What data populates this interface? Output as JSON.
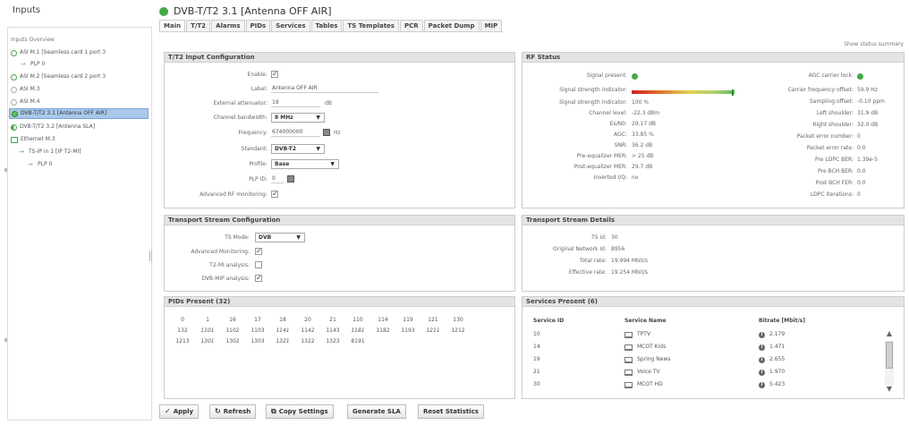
{
  "sidebar": {
    "title": "Inputs",
    "overview": "Inputs Overview",
    "items": [
      {
        "label": "ASI M.1 [Seamless card 1 port 3",
        "icon": "ring-icon"
      },
      {
        "label": "PLP 0",
        "icon": "plp-icon"
      },
      {
        "label": "ASI M.2 [Seamless card 2 port 3",
        "icon": "ring-icon"
      },
      {
        "label": "ASI M.3",
        "icon": "ring-empty-icon"
      },
      {
        "label": "ASI M.4",
        "icon": "ring-empty-icon"
      },
      {
        "label": "DVB-T/T2 3.1 [Antenna OFF AIR]",
        "icon": "ring-selected-icon"
      },
      {
        "label": "DVB-T/T2 3.2 [Antenna SLA]",
        "icon": "ring-half-icon"
      },
      {
        "label": "Ethernet M.3",
        "icon": "ethernet-icon"
      },
      {
        "label": "TS-IP in 1 [IP T2-MI]",
        "icon": "ts-ip-icon"
      },
      {
        "label": "PLP 0",
        "icon": "plp-icon"
      }
    ]
  },
  "header": {
    "title": "DVB-T/T2 3.1 [Antenna OFF AIR]",
    "status_color": "#44aa44"
  },
  "tabs": [
    "Main",
    "T/T2",
    "Alarms",
    "PIDs",
    "Services",
    "Tables",
    "TS Templates",
    "PCR",
    "Packet Dump",
    "MIP"
  ],
  "show_status_summary": "Show status summary",
  "t2_input": {
    "title": "T/T2 Input Configuration",
    "enable_label": "Enable:",
    "enable_checked": true,
    "label_label": "Label:",
    "label_value": "Antenna OFF AIR",
    "ext_att_label": "External attenuator:",
    "ext_att_value": "19",
    "ext_att_unit": "dB",
    "bandwidth_label": "Channel bandwidth:",
    "bandwidth_value": "8 MHz",
    "freq_label": "Frequency:",
    "freq_value": "674000000",
    "freq_unit": "Hz",
    "standard_label": "Standard:",
    "standard_value": "DVB-T2",
    "profile_label": "Profile:",
    "profile_value": "Base",
    "plp_label": "PLP ID:",
    "plp_value": "0",
    "adv_rf_label": "Advanced RF monitoring:",
    "adv_rf_checked": true
  },
  "rf_status": {
    "title": "RF Status",
    "signal_present_label": "Signal present:",
    "signal_strength_label": "Signal strength indicator:",
    "signal_strength_fraction": 0.97,
    "signal_strength_ind_label": "Signal strength indicator:",
    "signal_strength_ind_value": "100 %",
    "channel_level_label": "Channel level:",
    "channel_level_value": "-22.3 dBm",
    "esno_label": "Es/N0:",
    "esno_value": "29.17 dB",
    "agc_label": "AGC:",
    "agc_value": "33.85 %",
    "snr_label": "SNR:",
    "snr_value": "36.2 dB",
    "pre_mer_label": "Pre-equalizer MER:",
    "pre_mer_value": "> 25 dB",
    "post_mer_label": "Post-equalizer MER:",
    "post_mer_value": "29.7 dB",
    "inv_iq_label": "Inverted I/Q:",
    "inv_iq_value": "no",
    "agc_lock_label": "AGC carrier lock:",
    "cfo_label": "Carrier frequency offset:",
    "cfo_value": "59.9 Hz",
    "so_label": "Sampling offset:",
    "so_value": "-0.10 ppm",
    "ls_label": "Left shoulder:",
    "ls_value": "31.9 dB",
    "rs_label": "Right shoulder:",
    "rs_value": "32.0 dB",
    "pen_label": "Packet error number:",
    "pen_value": "0",
    "per_label": "Packet error rate:",
    "per_value": "0.0",
    "pre_ldpc_label": "Pre LDPC BER:",
    "pre_ldpc_value": "1.39e-5",
    "pre_bch_label": "Pre BCH BER:",
    "pre_bch_value": "0.0",
    "post_bch_label": "Post BCH FER:",
    "post_bch_value": "0.0",
    "ldpc_it_label": "LDPC iterations:",
    "ldpc_it_value": "0"
  },
  "ts_config": {
    "title": "Transport Stream Configuration",
    "mode_label": "TS Mode:",
    "mode_value": "DVB",
    "adv_mon_label": "Advanced Monitoring:",
    "adv_mon_checked": true,
    "t2mi_label": "T2-MI analysis:",
    "t2mi_checked": false,
    "dvbmip_label": "DVB-MIP analysis:",
    "dvbmip_checked": true
  },
  "ts_details": {
    "title": "Transport Stream Details",
    "tsid_label": "TS id:",
    "tsid_value": "30",
    "onid_label": "Original Network Id:",
    "onid_value": "8956",
    "total_label": "Total rate:",
    "total_value": "19.994 Mbit/s",
    "eff_label": "Effective rate:",
    "eff_value": "19.254 Mbit/s"
  },
  "pids": {
    "title": "PIDs Present (32)",
    "rows": [
      [
        {
          "v": "0",
          "i": false
        },
        {
          "v": "1",
          "i": false
        },
        {
          "v": "16",
          "i": false
        },
        {
          "v": "17",
          "i": false
        },
        {
          "v": "18",
          "i": false
        },
        {
          "v": "20",
          "i": false
        },
        {
          "v": "21",
          "i": false
        },
        {
          "v": "110",
          "i": false
        },
        {
          "v": "114",
          "i": false
        },
        {
          "v": "119",
          "i": false
        },
        {
          "v": "121",
          "i": false
        },
        {
          "v": "130",
          "i": false
        }
      ],
      [
        {
          "v": "132",
          "i": false
        },
        {
          "v": "1101",
          "i": true
        },
        {
          "v": "1102",
          "i": false
        },
        {
          "v": "1103",
          "i": false
        },
        {
          "v": "1141",
          "i": true
        },
        {
          "v": "1142",
          "i": false
        },
        {
          "v": "1143",
          "i": false
        },
        {
          "v": "1181",
          "i": true
        },
        {
          "v": "1182",
          "i": false
        },
        {
          "v": "1193",
          "i": false
        },
        {
          "v": "1211",
          "i": true
        },
        {
          "v": "1212",
          "i": false
        }
      ],
      [
        {
          "v": "1213",
          "i": false
        },
        {
          "v": "1301",
          "i": true
        },
        {
          "v": "1302",
          "i": false
        },
        {
          "v": "1303",
          "i": false
        },
        {
          "v": "1321",
          "i": true
        },
        {
          "v": "1322",
          "i": false
        },
        {
          "v": "1323",
          "i": false
        },
        {
          "v": "8191",
          "i": false
        }
      ]
    ]
  },
  "services": {
    "title": "Services Present (6)",
    "col_id": "Service ID",
    "col_name": "Service Name",
    "col_bitrate": "Bitrate [Mbit/s]",
    "rows": [
      {
        "id": "10",
        "name": "TPTV",
        "bitrate": "2.179"
      },
      {
        "id": "14",
        "name": "MCOT Kids",
        "bitrate": "1.471"
      },
      {
        "id": "19",
        "name": "Spring News",
        "bitrate": "2.655"
      },
      {
        "id": "21",
        "name": "Voice TV",
        "bitrate": "1.970"
      },
      {
        "id": "30",
        "name": "MCOT HD",
        "bitrate": "5.423"
      }
    ]
  },
  "buttons": {
    "apply": "Apply",
    "refresh": "Refresh",
    "copy": "Copy Settings",
    "sla": "Generate SLA",
    "reset": "Reset Statistics"
  }
}
